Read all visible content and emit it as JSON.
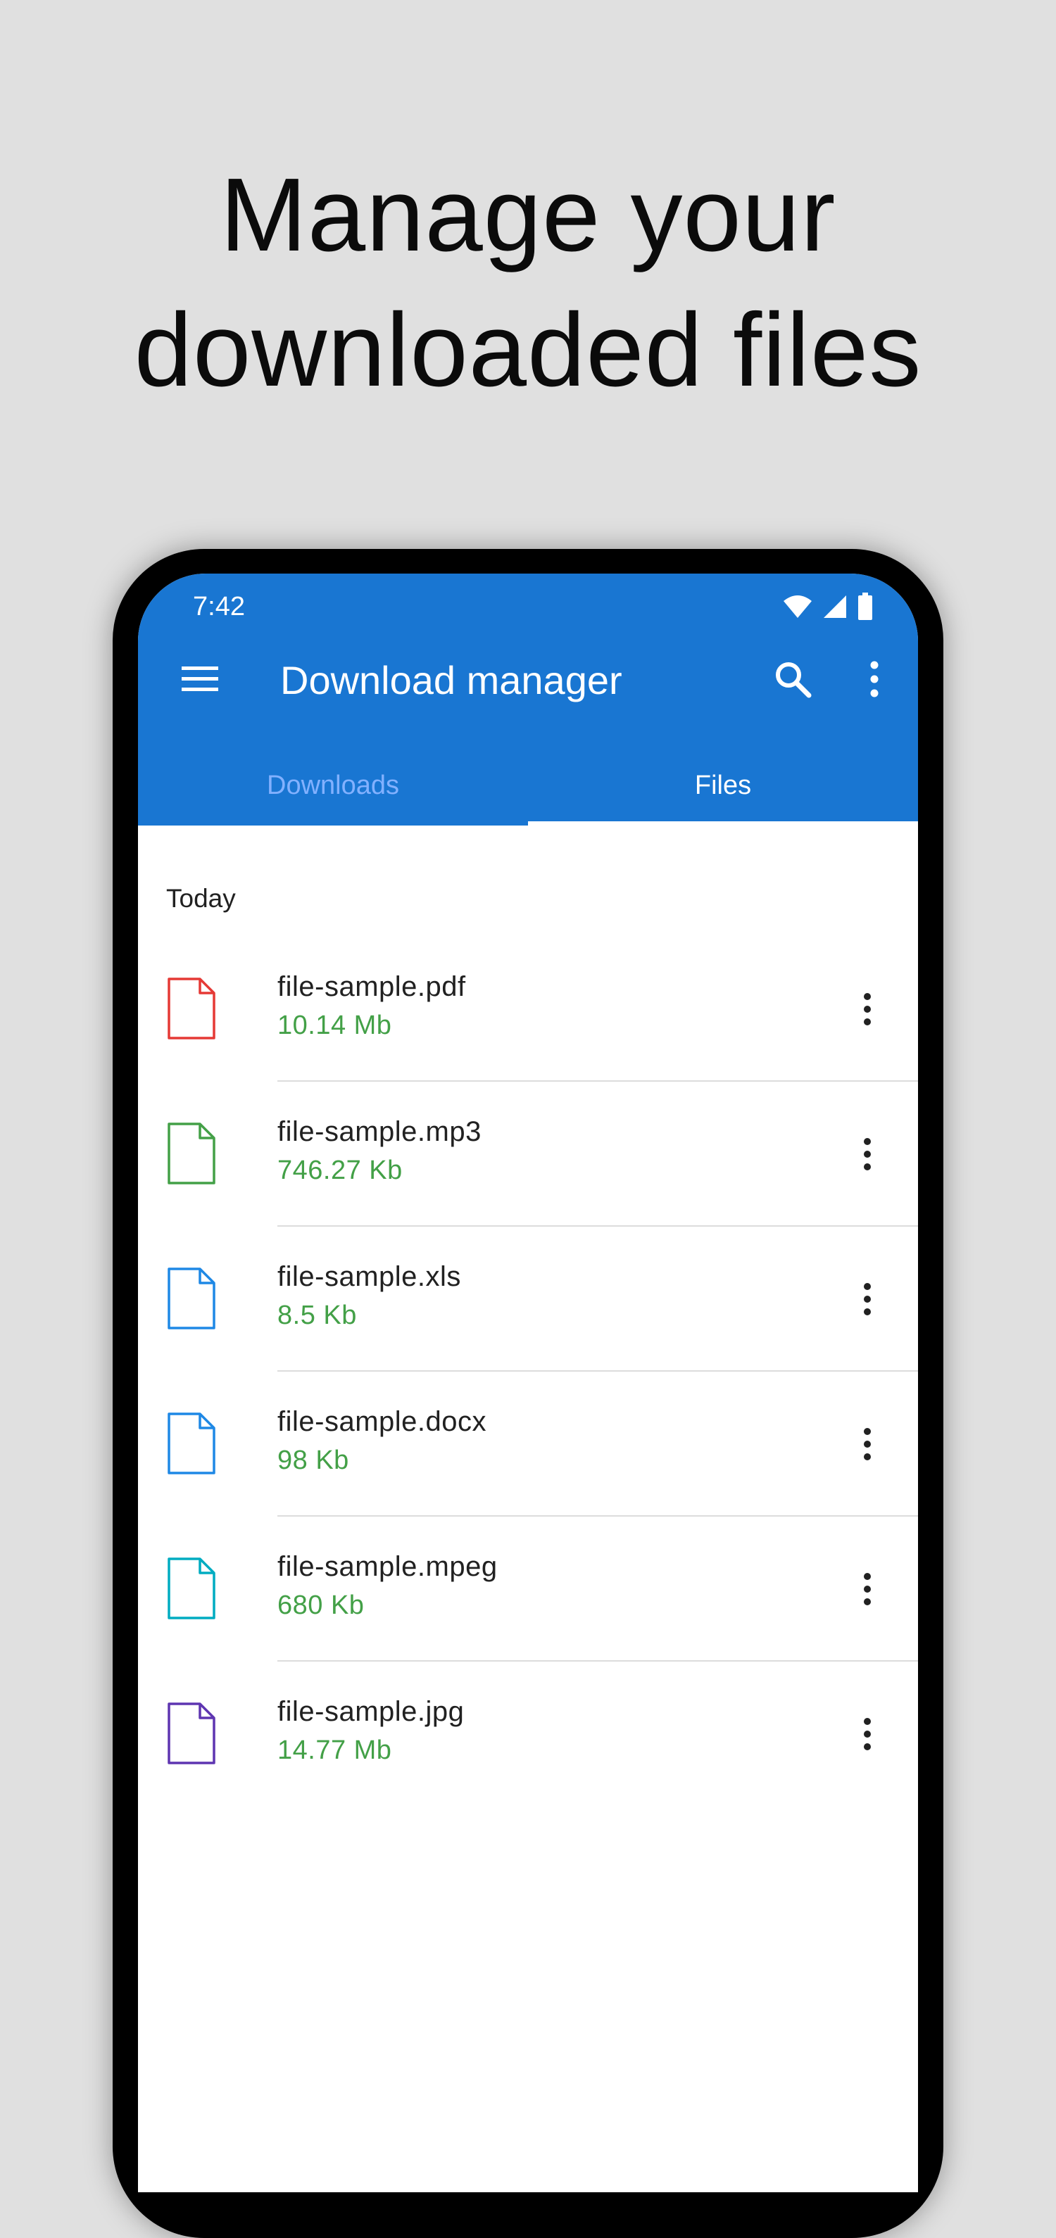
{
  "headline": {
    "line1": "Manage your",
    "line2": "downloaded files"
  },
  "status_bar": {
    "time": "7:42",
    "icons": [
      "wifi-icon",
      "signal-icon",
      "battery-icon"
    ]
  },
  "toolbar": {
    "title": "Download manager",
    "menu_icon": "hamburger-menu-icon",
    "search_icon": "search-icon",
    "more_icon": "more-vertical-icon"
  },
  "tabs": [
    {
      "label": "Downloads",
      "selected": false
    },
    {
      "label": "Files",
      "selected": true
    }
  ],
  "section": {
    "header": "Today"
  },
  "files": [
    {
      "name": "file-sample.pdf",
      "size": "10.14 Mb",
      "icon_color": "#e53935"
    },
    {
      "name": "file-sample.mp3",
      "size": "746.27 Kb",
      "icon_color": "#43a047"
    },
    {
      "name": "file-sample.xls",
      "size": "8.5 Kb",
      "icon_color": "#1e88e5"
    },
    {
      "name": "file-sample.docx",
      "size": "98 Kb",
      "icon_color": "#1e88e5"
    },
    {
      "name": "file-sample.mpeg",
      "size": "680 Kb",
      "icon_color": "#00acc1"
    },
    {
      "name": "file-sample.jpg",
      "size": "14.77 Mb",
      "icon_color": "#5e35b1"
    }
  ],
  "colors": {
    "primary": "#1976d2",
    "size_text": "#43a047",
    "tab_inactive": "#82b1ff"
  }
}
